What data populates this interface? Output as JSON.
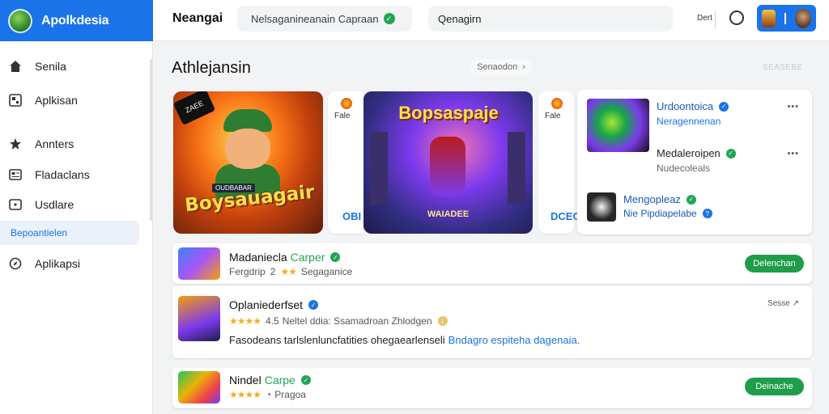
{
  "app": {
    "name": "Apolkdesia"
  },
  "sidebar": {
    "items": [
      {
        "label": "Senila",
        "icon": "home-icon"
      },
      {
        "label": "Aplkisan",
        "icon": "apps-icon"
      },
      {
        "label": "Annters",
        "icon": "star-icon"
      },
      {
        "label": "Fladaclans",
        "icon": "news-icon"
      },
      {
        "label": "Usdlare",
        "icon": "update-icon"
      },
      {
        "label": "Bepoantielen",
        "icon": ""
      },
      {
        "label": "Aplikapsi",
        "icon": "compass-icon"
      }
    ]
  },
  "topbar": {
    "title": "Neangai",
    "search1": "Nelsaganineanain Capraan",
    "search2": "Qenagirn",
    "small_text": "Dert"
  },
  "section": {
    "title": "Athlejansin",
    "see_more": "Senaodon",
    "faint_link": "SEASEBE"
  },
  "featured": {
    "game1": {
      "badge": "ZAEE",
      "banner": "OUDBABAR",
      "title": "Boysauagair"
    },
    "mini1": {
      "top": "Fale",
      "bottom": "OBI"
    },
    "game2": {
      "title": "Bopsaspaje",
      "subtitle": "WAIADEE"
    },
    "mini2": {
      "top": "Fale",
      "bottom": "DCEO"
    }
  },
  "panel": {
    "items": [
      {
        "name": "Urdoontoica",
        "sub": "Neragennenan",
        "more": "•••"
      },
      {
        "name": "Medaleroipen",
        "sub": "Nudecoleals",
        "more": "•••"
      },
      {
        "name": "Mengopleaz",
        "sub": "Nie Pipdiapelabe"
      }
    ],
    "colors": {
      "name_blue": "#1a57b8",
      "sub_blue": "#1a73e8",
      "sub_gray": "#666666"
    }
  },
  "list": [
    {
      "name": "Madaniecla",
      "accent": "Carper",
      "rating_label": "Fergdrip",
      "rating": "2",
      "stars": "★★",
      "meta": "Segaganice",
      "button": "Delenchan"
    },
    {
      "name": "Oplaniederfset",
      "stars": "★★★★",
      "rating": "4.5",
      "meta": "Neltel ddia: Ssamadroan Zhlodgen",
      "more": "Sesse",
      "desc": "Fasodeans tarlslenluncfatities ohegaearlenseli",
      "desc_link": "Bndagro espiteha dagenaia."
    },
    {
      "name": "Nindel",
      "accent": "Carpe",
      "stars": "★★★★",
      "meta": "Pragoa",
      "button": "Deinache"
    }
  ],
  "colors": {
    "accent": "#1a73e8",
    "primary_green": "#1f9d49",
    "star": "#f2b01e",
    "brand_bar": "#1a73e8"
  }
}
